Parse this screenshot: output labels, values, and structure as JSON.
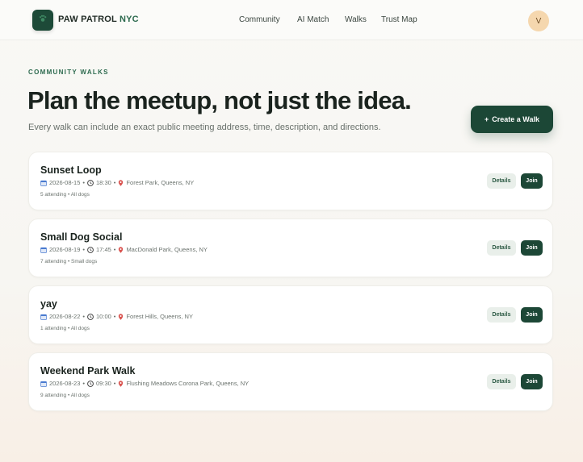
{
  "nav": {
    "brand_main": "PAW PATROL",
    "brand_accent": "NYC",
    "links": [
      "Community",
      "AI Match",
      "Walks",
      "Trust Map"
    ],
    "avatar_initial": "V"
  },
  "hero": {
    "eyebrow": "COMMUNITY WALKS",
    "headline": "Plan the meetup, not just the idea.",
    "subtitle": "Every walk can include an exact public meeting address, time, description, and directions.",
    "create_label": "Create a Walk",
    "create_icon": "+"
  },
  "walks": [
    {
      "title": "Sunset Loop",
      "date": "2026-08-15",
      "time": "18:30",
      "location": "Forest Park, Queens, NY",
      "attending": "5 attending • All dogs"
    },
    {
      "title": "Small Dog Social",
      "date": "2026-08-19",
      "time": "17:45",
      "location": "MacDonald Park, Queens, NY",
      "attending": "7 attending • Small dogs"
    },
    {
      "title": "yay",
      "date": "2026-08-22",
      "time": "10:00",
      "location": "Forest Hills, Queens, NY",
      "attending": "1 attending • All dogs"
    },
    {
      "title": "Weekend Park Walk",
      "date": "2026-08-23",
      "time": "09:30",
      "location": "Flushing Meadows Corona Park, Queens, NY",
      "attending": "9 attending • All dogs"
    }
  ],
  "card_actions": {
    "details_label": "Details",
    "join_label": "Join"
  },
  "meta_separator": "•",
  "icons": {
    "date": "calendar-icon",
    "time": "clock-icon",
    "location": "pin-icon",
    "logo": "paw-icon"
  },
  "colors": {
    "brand": "#1c4736",
    "accent": "#2c6a4e",
    "avatar": "#f5d7ae",
    "pin": "#d9534f",
    "calendar": "#4a7bd0"
  }
}
